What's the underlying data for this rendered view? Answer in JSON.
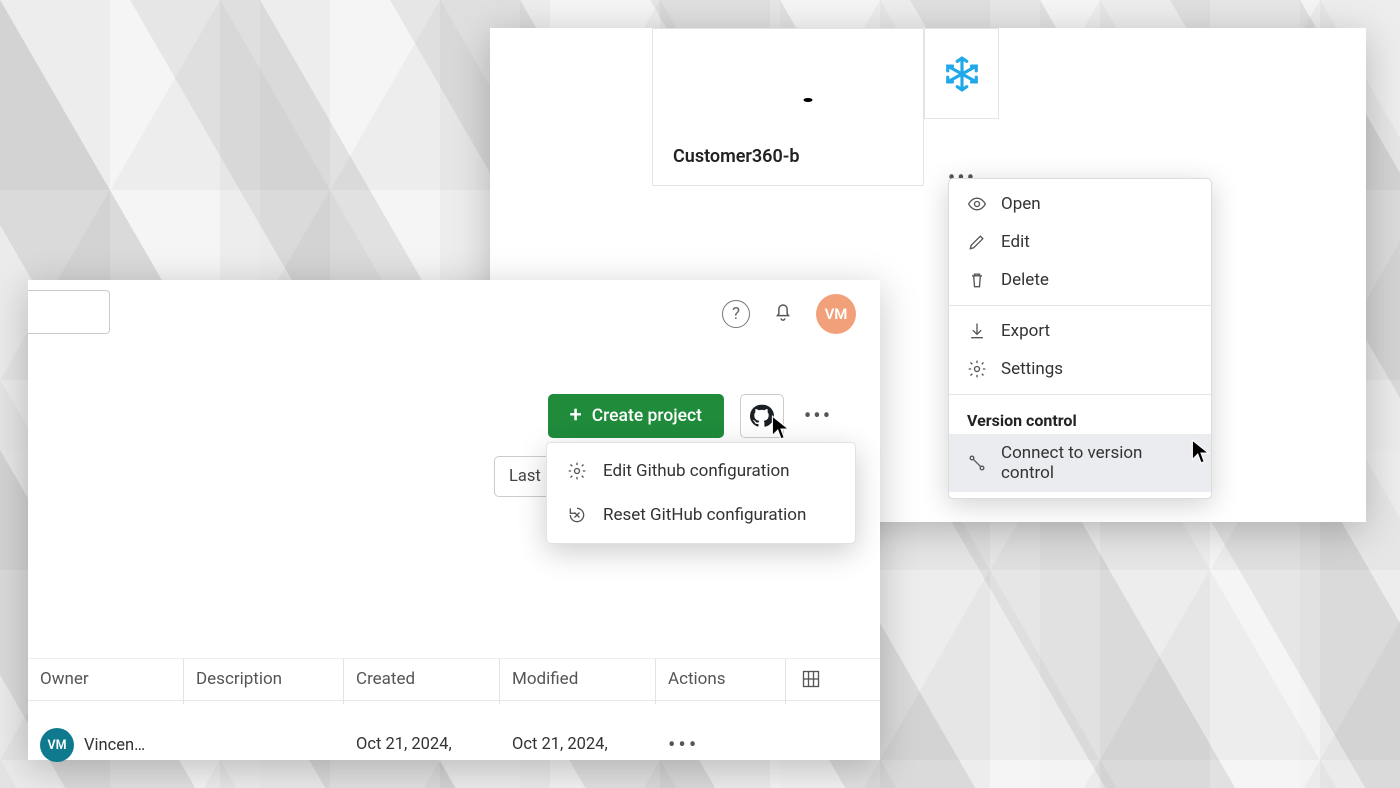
{
  "top_panel": {
    "card_title": "Customer360-b",
    "menu": {
      "open": "Open",
      "edit": "Edit",
      "delete": "Delete",
      "export": "Export",
      "settings": "Settings",
      "section_label": "Version control",
      "connect_vc": "Connect to version control"
    }
  },
  "bottom_panel": {
    "avatar_initials": "VM",
    "create_button": "Create project",
    "last_filter_fragment": "Last r",
    "gh_menu": {
      "edit": "Edit Github configuration",
      "reset": "Reset GitHub configuration"
    },
    "table": {
      "headers": {
        "owner": "Owner",
        "description": "Description",
        "created": "Created",
        "modified": "Modified",
        "actions": "Actions"
      },
      "rows": [
        {
          "owner_avatar": "VM",
          "owner_name": "Vincen…",
          "description": "",
          "created": "Oct 21, 2024,",
          "modified": "Oct 21, 2024,"
        }
      ]
    }
  }
}
